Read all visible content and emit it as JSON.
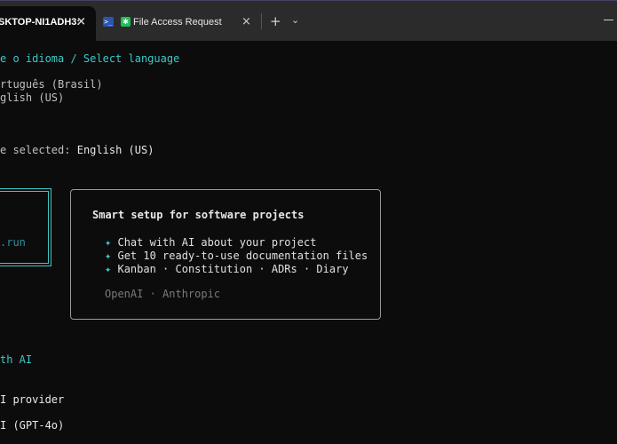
{
  "tabs": [
    {
      "label": "SKTOP-NI1ADH3:",
      "close_icon": "×",
      "active": true
    },
    {
      "label": "File Access Request",
      "close_icon": "×",
      "active": false,
      "ps_glyph": ">_",
      "app_glyph": "✱"
    }
  ],
  "tabbar": {
    "new_tab": "+",
    "dropdown": "⌄"
  },
  "terminal": {
    "language_prompt": "e o idioma / Select language",
    "option_pt": "rtuguês (Brasil)",
    "option_en": "glish (US)",
    "selected_label": "e selected:",
    "selected_value": "English (US)",
    "banner_suffix": ".run",
    "ai_heading": "th AI",
    "provider_label": "I provider",
    "provider_value": "I (GPT-4o)"
  },
  "card": {
    "title": "Smart setup for software projects",
    "bullet": "✦",
    "items": [
      "Chat with AI about your project",
      "Get 10 ready-to-use documentation files",
      "Kanban · Constitution · ADRs · Diary"
    ],
    "providers": "OpenAI · Anthropic"
  },
  "colors": {
    "accent": "#3fc7c7",
    "background": "#0c0c0c",
    "tabbar": "#2b2b2b"
  }
}
